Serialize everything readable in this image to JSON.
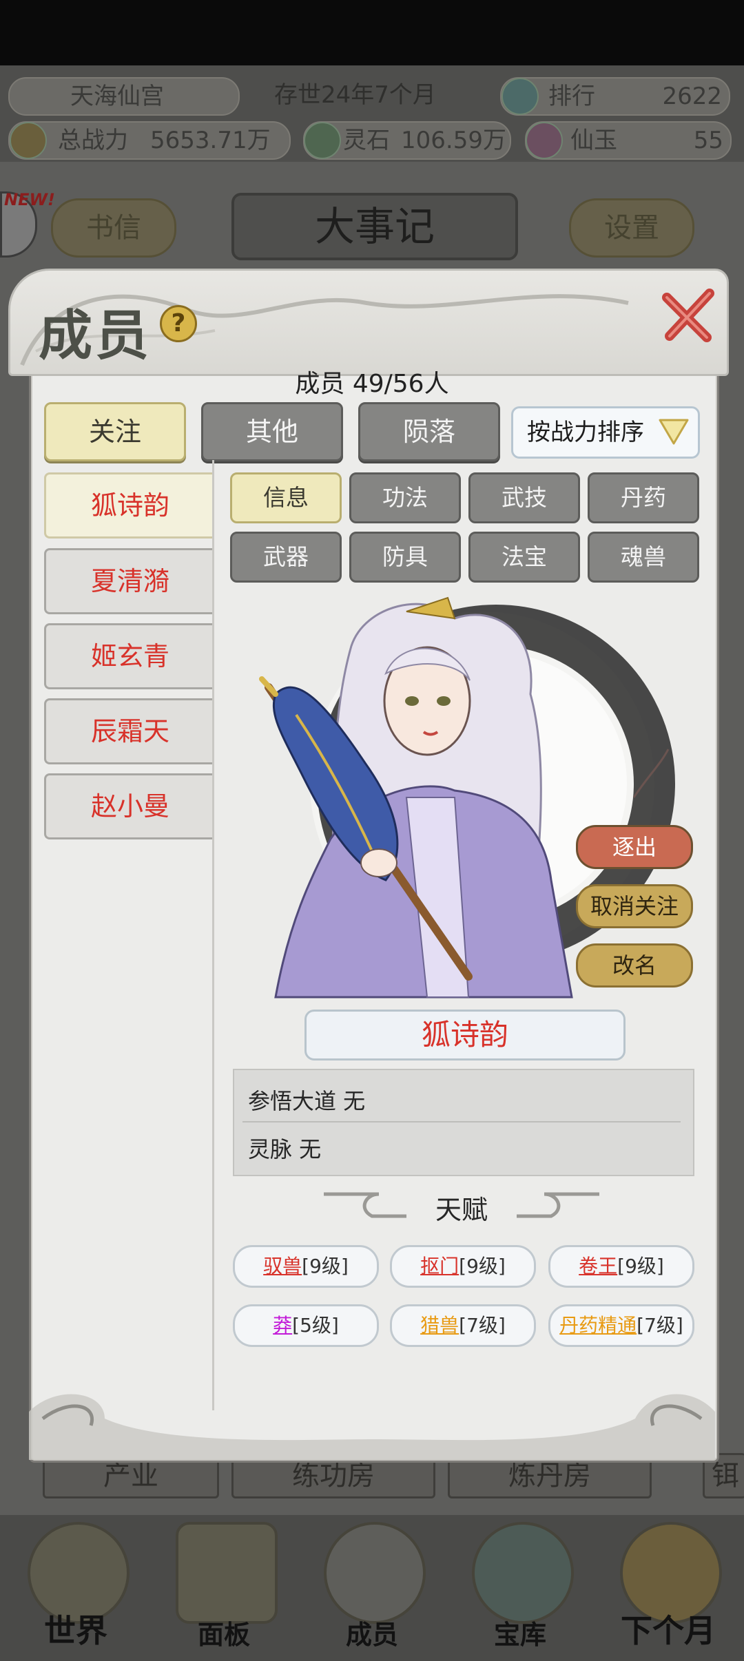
{
  "top_bar": {
    "sect_name": "天海仙宫",
    "age": "存世24年7个月",
    "rank_label": "排行",
    "rank_value": "2622",
    "power_label": "总战力",
    "power_value": "5653.71万",
    "spirit_stone_label": "灵石",
    "spirit_stone_value": "106.59万",
    "jade_label": "仙玉",
    "jade_value": "55"
  },
  "nav_row": {
    "new_badge": "NEW!",
    "letters_button": "书信",
    "events_title": "大事记",
    "settings_button": "设置"
  },
  "background_buildings": [
    "产业",
    "练功房",
    "炼丹房",
    "铒"
  ],
  "bottom_nav": [
    {
      "label": "世界"
    },
    {
      "label": "面板"
    },
    {
      "label": "成员"
    },
    {
      "label": "宝库"
    },
    {
      "label": "下个月"
    }
  ],
  "panel": {
    "title": "成员",
    "help_icon": "?",
    "member_count": "成员  49/56人",
    "tabs": [
      {
        "label": "关注",
        "active": true
      },
      {
        "label": "其他",
        "active": false
      },
      {
        "label": "陨落",
        "active": false
      }
    ],
    "sort_label": "按战力排序",
    "members": [
      {
        "name": "狐诗韵",
        "active": true
      },
      {
        "name": "夏清漪",
        "active": false
      },
      {
        "name": "姬玄青",
        "active": false
      },
      {
        "name": "辰霜天",
        "active": false
      },
      {
        "name": "赵小曼",
        "active": false
      }
    ],
    "sub_tabs": [
      {
        "label": "信息",
        "active": true
      },
      {
        "label": "功法",
        "active": false
      },
      {
        "label": "武技",
        "active": false
      },
      {
        "label": "丹药",
        "active": false
      },
      {
        "label": "武器",
        "active": false
      },
      {
        "label": "防具",
        "active": false
      },
      {
        "label": "法宝",
        "active": false
      },
      {
        "label": "魂兽",
        "active": false
      }
    ],
    "actions": {
      "expel": "逐出",
      "unfollow": "取消关注",
      "rename": "改名"
    },
    "selected_name": "狐诗韵",
    "info": {
      "dao": "参悟大道 无",
      "vein": "灵脉 无"
    },
    "talent_title": "天赋",
    "talents": [
      {
        "name": "驭兽",
        "level": "[9级]",
        "color": "#d8322a"
      },
      {
        "name": "抠门",
        "level": "[9级]",
        "color": "#d8322a"
      },
      {
        "name": "卷王",
        "level": "[9级]",
        "color": "#d8322a"
      },
      {
        "name": "莽",
        "level": "[5级]",
        "color": "#c21ad8"
      },
      {
        "name": "猎兽",
        "level": "[7级]",
        "color": "#e89a12"
      },
      {
        "name": "丹药精通",
        "level": "[7级]",
        "color": "#e89a12"
      }
    ]
  }
}
